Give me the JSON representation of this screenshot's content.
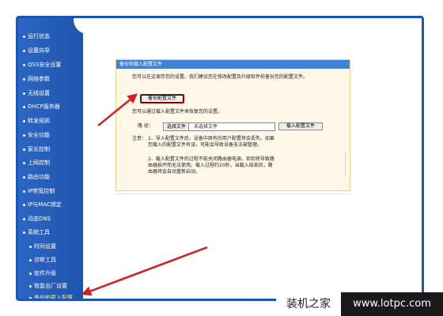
{
  "sidebar": {
    "items": [
      {
        "label": "运行状态"
      },
      {
        "label": "设置向导"
      },
      {
        "label": "QSS安全设置"
      },
      {
        "label": "网络参数"
      },
      {
        "label": "无线设置"
      },
      {
        "label": "DHCP服务器"
      },
      {
        "label": "转发规则"
      },
      {
        "label": "安全功能"
      },
      {
        "label": "家长控制"
      },
      {
        "label": "上网控制"
      },
      {
        "label": "路由功能"
      },
      {
        "label": "IP带宽控制"
      },
      {
        "label": "IP与MAC绑定"
      },
      {
        "label": "动态DNS"
      },
      {
        "label": "系统工具"
      }
    ],
    "subitems": [
      {
        "label": "时间设置"
      },
      {
        "label": "诊断工具"
      },
      {
        "label": "软件升级"
      },
      {
        "label": "恢复出厂设置"
      },
      {
        "label": "备份和载入配置"
      }
    ]
  },
  "panel": {
    "title": "备份和载入配置文件",
    "backup_desc": "您可以在这保存您的设置。我们建议您在修改配置及升级软件前备份您的配置文件。",
    "backup_button": "备份配置文件",
    "load_desc": "您可以通过载入配置文件来恢复您的设置。",
    "path_label": "路 径：",
    "choose_file": "选择文件",
    "no_file": "未选择文件",
    "load_button": "载入配置文件",
    "note_label": "注意：",
    "note_1": "1、导入配置文件后，设备中原有的用户配置将会丢失。如果您载入的配置文件有误，可能会导致设备无法被管理。",
    "note_2": "2、载入配置文件的过程不能关闭路由器电源，否则将导致路由器损坏而无法使用。载入过程约20秒，当载入结束后，路由器将会自动重新启动。"
  },
  "watermark": {
    "left": "装机之家",
    "right": "www.lotpc.com"
  },
  "colors": {
    "sidebar": "#2159b6",
    "frame": "#1a55b8",
    "panel_header": "#3f84d4",
    "arrow": "#d21f1f",
    "active_item": "#ffe98a"
  }
}
